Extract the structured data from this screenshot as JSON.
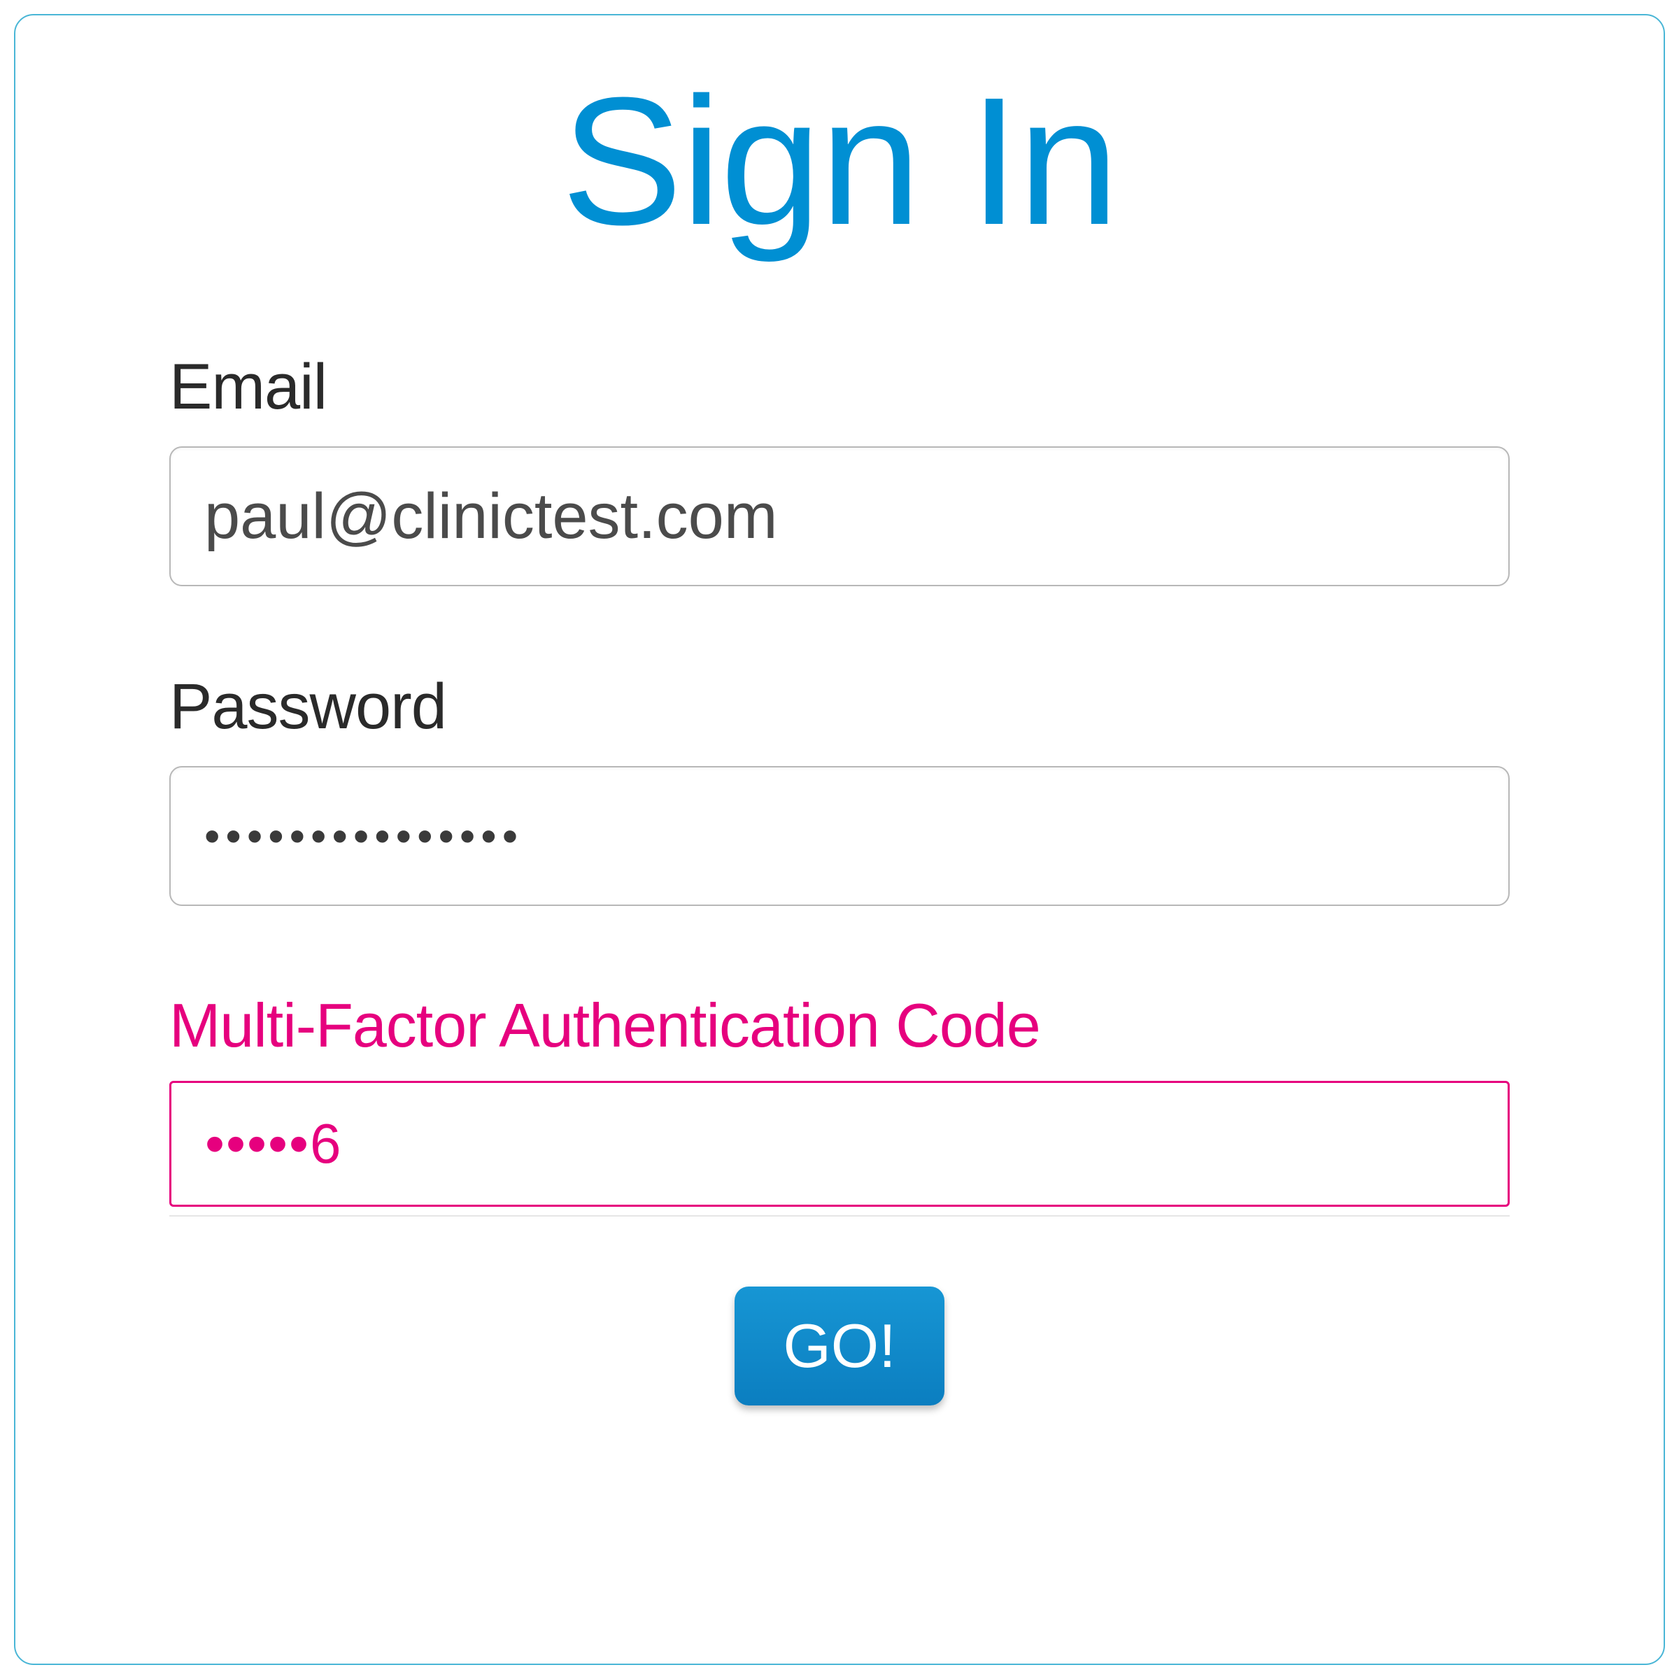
{
  "title": "Sign In",
  "email": {
    "label": "Email",
    "value": "paul@clinictest.com"
  },
  "password": {
    "label": "Password",
    "value": "•••••••••••••••"
  },
  "mfa": {
    "label": "Multi-Factor Authentication Code",
    "value": "•••••6"
  },
  "submit": {
    "label": "GO!"
  },
  "colors": {
    "title": "#008fd3",
    "border": "#4ab6d6",
    "accent_pink": "#e6007e",
    "button": "#0b86c9"
  }
}
